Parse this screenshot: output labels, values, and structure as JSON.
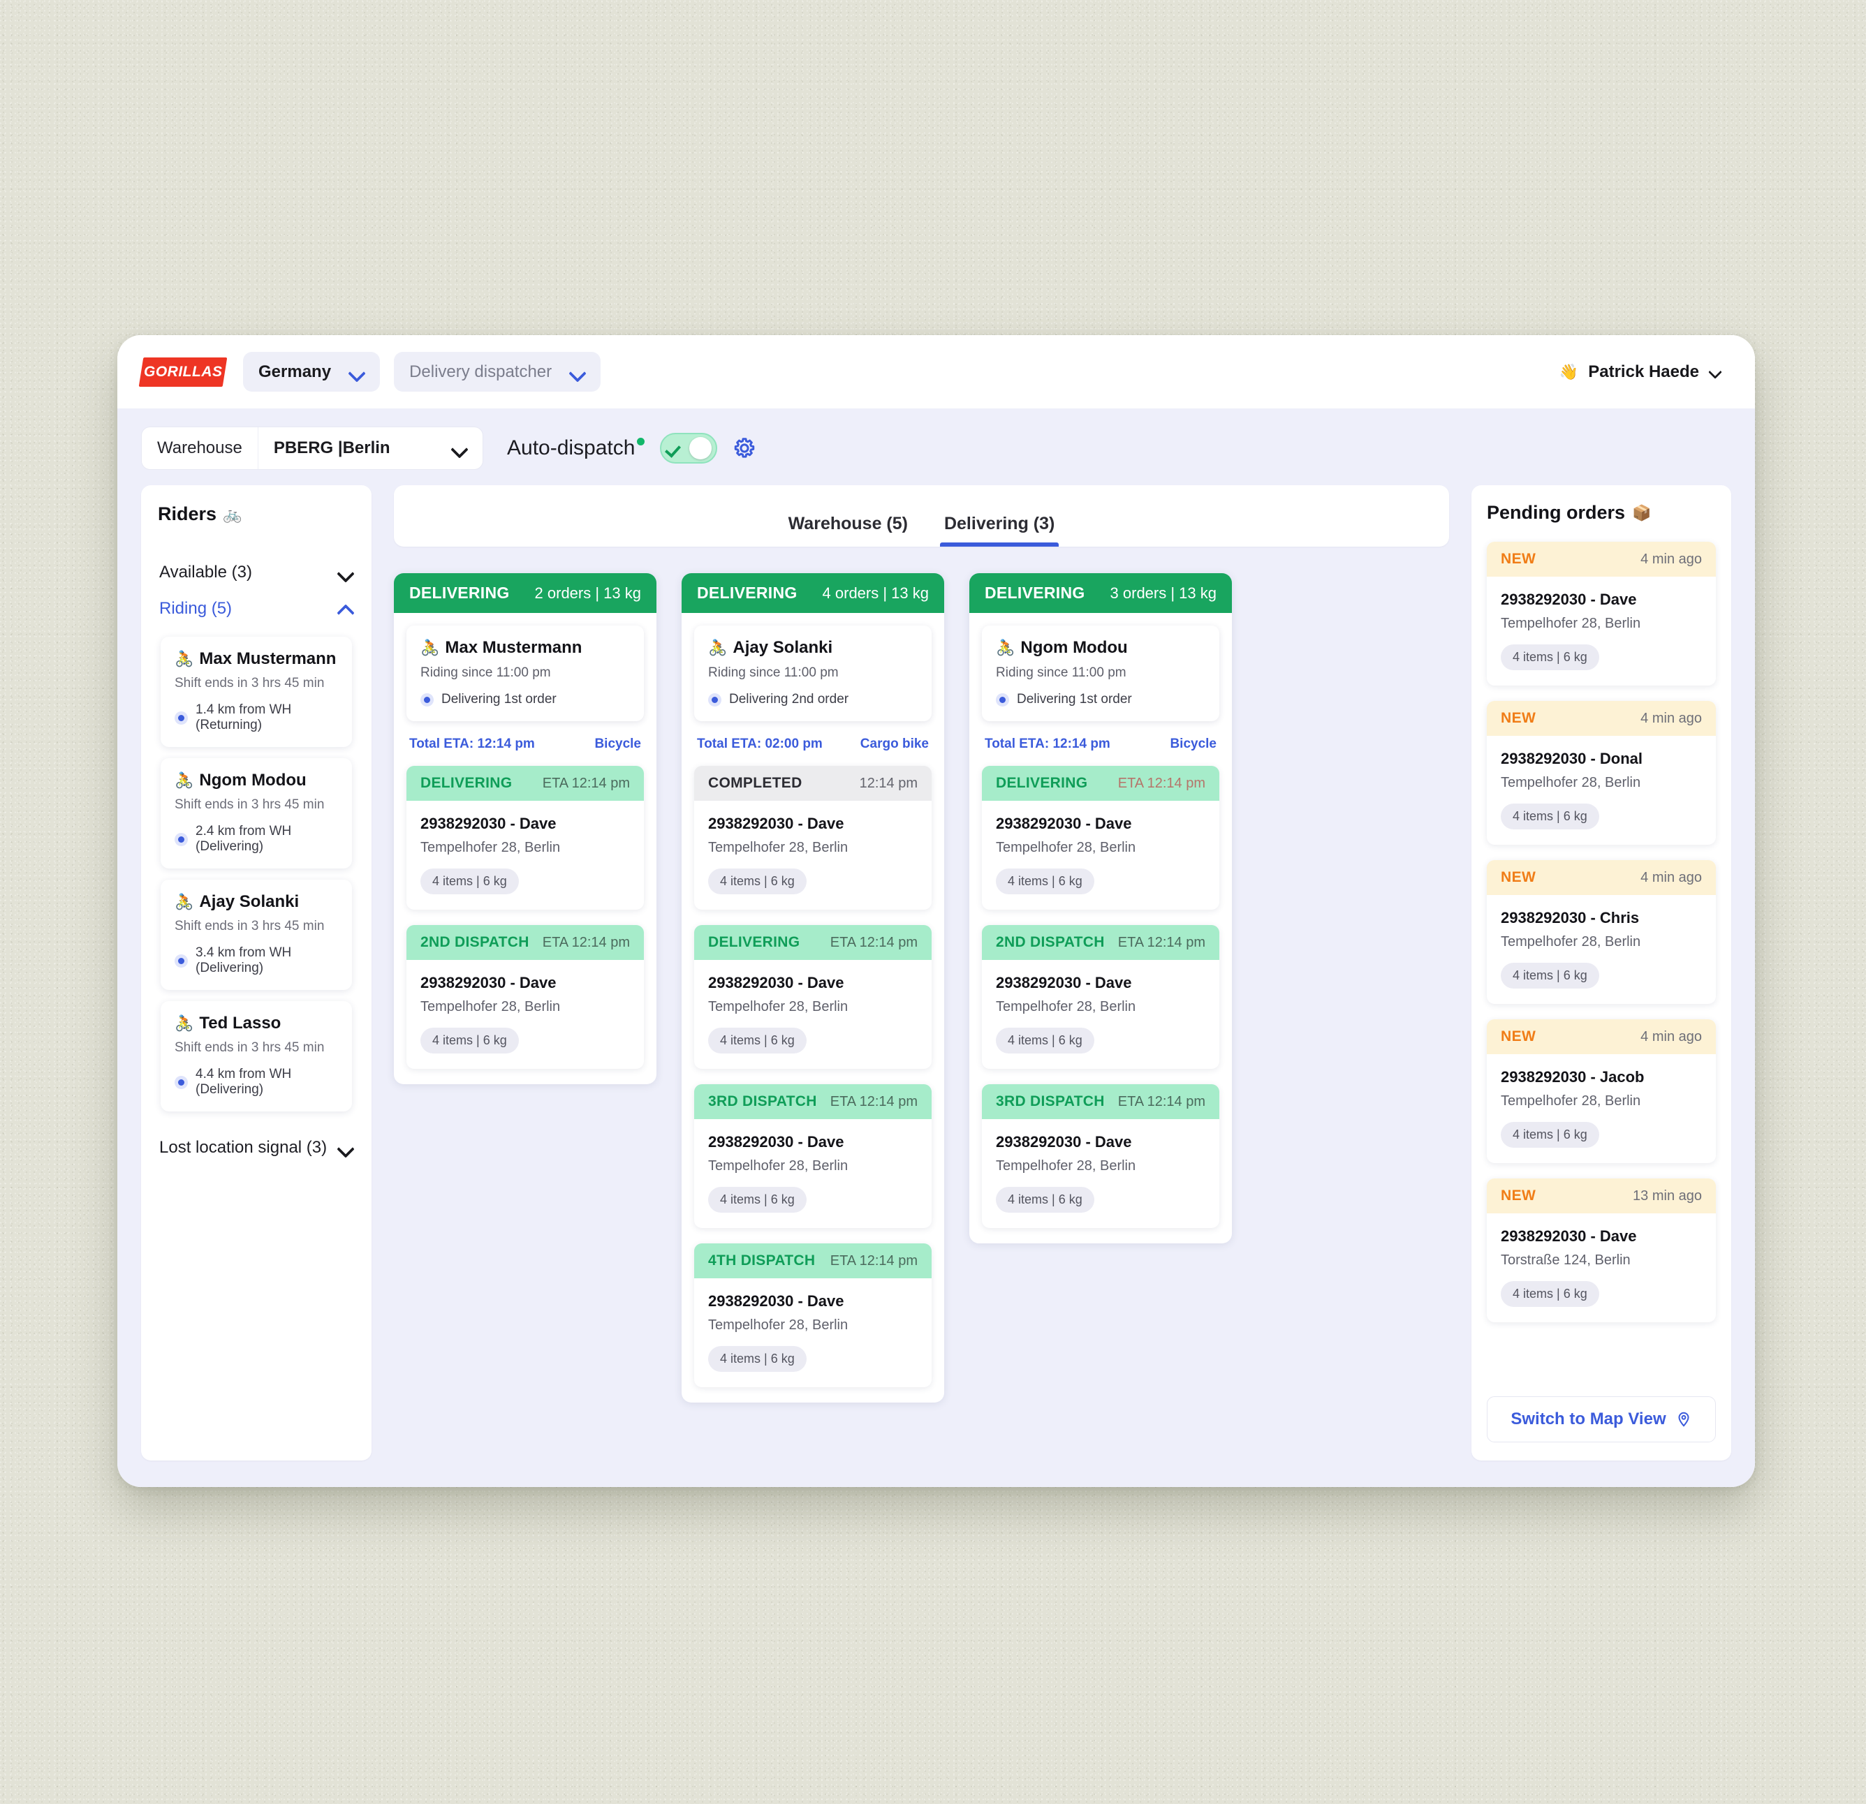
{
  "topbar": {
    "logo_text": "GORILLAS",
    "country": "Germany",
    "role": "Delivery dispatcher",
    "user_name": "Patrick Haede",
    "user_emoji": "👋"
  },
  "subbar": {
    "warehouse_label": "Warehouse",
    "warehouse_value": "PBERG |Berlin",
    "auto_dispatch_label": "Auto-dispatch",
    "auto_dispatch_on": true
  },
  "riders_panel": {
    "title": "Riders",
    "title_emoji": "🚲",
    "groups": [
      {
        "label": "Available (3)",
        "expanded": false,
        "active": false
      },
      {
        "label": "Riding (5)",
        "expanded": true,
        "active": true
      },
      {
        "label": "Lost location signal (3)",
        "expanded": false,
        "active": false
      }
    ],
    "riders": [
      {
        "emoji": "🚴",
        "name": "Max Mustermann",
        "shift": "Shift ends in 3 hrs 45 min",
        "distance": "1.4 km from WH (Returning)"
      },
      {
        "emoji": "🚴",
        "name": "Ngom Modou",
        "shift": "Shift ends in 3 hrs 45 min",
        "distance": "2.4 km from WH (Delivering)"
      },
      {
        "emoji": "🚴",
        "name": "Ajay Solanki",
        "shift": "Shift ends in 3 hrs 45 min",
        "distance": "3.4 km from WH (Delivering)"
      },
      {
        "emoji": "🚴",
        "name": "Ted Lasso",
        "shift": "Shift ends in 3 hrs 45 min",
        "distance": "4.4 km from WH (Delivering)"
      }
    ]
  },
  "tabs": [
    {
      "label": "Warehouse (5)",
      "active": false
    },
    {
      "label": "Delivering (3)",
      "active": true
    }
  ],
  "delivery_cards": [
    {
      "status": "DELIVERING",
      "meta": "2 orders | 13 kg",
      "rider_emoji": "🚴",
      "rider_name": "Max Mustermann",
      "riding_since": "Riding since 11:00 pm",
      "order_state": "Delivering 1st order",
      "total_eta": "Total ETA: 12:14 pm",
      "vehicle": "Bicycle",
      "dispatches": [
        {
          "label": "DELIVERING",
          "time": "ETA 12:14 pm",
          "style": "green",
          "order_id": "2938292030 - Dave",
          "address": "Tempelhofer 28, Berlin",
          "chip": "4 items | 6 kg"
        },
        {
          "label": "2ND DISPATCH",
          "time": "ETA 12:14 pm",
          "style": "green",
          "order_id": "2938292030 - Dave",
          "address": "Tempelhofer 28, Berlin",
          "chip": "4 items | 6 kg"
        }
      ]
    },
    {
      "status": "DELIVERING",
      "meta": "4 orders | 13 kg",
      "rider_emoji": "🚴",
      "rider_name": "Ajay Solanki",
      "riding_since": "Riding since 11:00 pm",
      "order_state": "Delivering 2nd order",
      "total_eta": "Total ETA: 02:00 pm",
      "vehicle": "Cargo bike",
      "dispatches": [
        {
          "label": "COMPLETED",
          "time": "12:14 pm",
          "style": "grey",
          "order_id": "2938292030 - Dave",
          "address": "Tempelhofer 28, Berlin",
          "chip": "4 items | 6 kg"
        },
        {
          "label": "DELIVERING",
          "time": "ETA 12:14 pm",
          "style": "green",
          "order_id": "2938292030 - Dave",
          "address": "Tempelhofer 28, Berlin",
          "chip": "4 items | 6 kg"
        },
        {
          "label": "3RD DISPATCH",
          "time": "ETA 12:14 pm",
          "style": "green",
          "order_id": "2938292030 - Dave",
          "address": "Tempelhofer 28, Berlin",
          "chip": "4 items | 6 kg"
        },
        {
          "label": "4TH DISPATCH",
          "time": "ETA 12:14 pm",
          "style": "green",
          "order_id": "2938292030 - Dave",
          "address": "Tempelhofer 28, Berlin",
          "chip": "4 items | 6 kg"
        }
      ]
    },
    {
      "status": "DELIVERING",
      "meta": "3 orders | 13 kg",
      "rider_emoji": "🚴",
      "rider_name": "Ngom Modou",
      "riding_since": "Riding since 11:00 pm",
      "order_state": "Delivering 1st order",
      "total_eta": "Total ETA: 12:14 pm",
      "vehicle": "Bicycle",
      "dispatches": [
        {
          "label": "DELIVERING",
          "time": "ETA 12:14 pm",
          "style": "warn",
          "order_id": "2938292030 - Dave",
          "address": "Tempelhofer 28, Berlin",
          "chip": "4 items | 6 kg"
        },
        {
          "label": "2ND DISPATCH",
          "time": "ETA 12:14 pm",
          "style": "green",
          "order_id": "2938292030 - Dave",
          "address": "Tempelhofer 28, Berlin",
          "chip": "4 items | 6 kg"
        },
        {
          "label": "3RD DISPATCH",
          "time": "ETA 12:14 pm",
          "style": "green",
          "order_id": "2938292030 - Dave",
          "address": "Tempelhofer 28, Berlin",
          "chip": "4 items | 6 kg"
        }
      ]
    }
  ],
  "pending_panel": {
    "title": "Pending orders",
    "title_emoji": "📦",
    "orders": [
      {
        "badge": "NEW",
        "ago": "4 min ago",
        "order_id": "2938292030 - Dave",
        "address": "Tempelhofer 28, Berlin",
        "chip": "4 items | 6 kg"
      },
      {
        "badge": "NEW",
        "ago": "4 min ago",
        "order_id": "2938292030 - Donal",
        "address": "Tempelhofer 28, Berlin",
        "chip": "4 items | 6 kg"
      },
      {
        "badge": "NEW",
        "ago": "4 min ago",
        "order_id": "2938292030 - Chris",
        "address": "Tempelhofer 28, Berlin",
        "chip": "4 items | 6 kg"
      },
      {
        "badge": "NEW",
        "ago": "4 min ago",
        "order_id": "2938292030 - Jacob",
        "address": "Tempelhofer 28, Berlin",
        "chip": "4 items | 6 kg"
      },
      {
        "badge": "NEW",
        "ago": "13 min ago",
        "order_id": "2938292030 - Dave",
        "address": "Torstraße 124, Berlin",
        "chip": "4 items | 6 kg"
      }
    ],
    "map_button": "Switch to Map View"
  },
  "colors": {
    "brand_red": "#ee3524",
    "accent_blue": "#3b5bdb",
    "status_green": "#19a55f",
    "dispatch_green_bg": "#a6ecca",
    "new_orange": "#f07d17",
    "new_bg": "#fdf2d5"
  }
}
